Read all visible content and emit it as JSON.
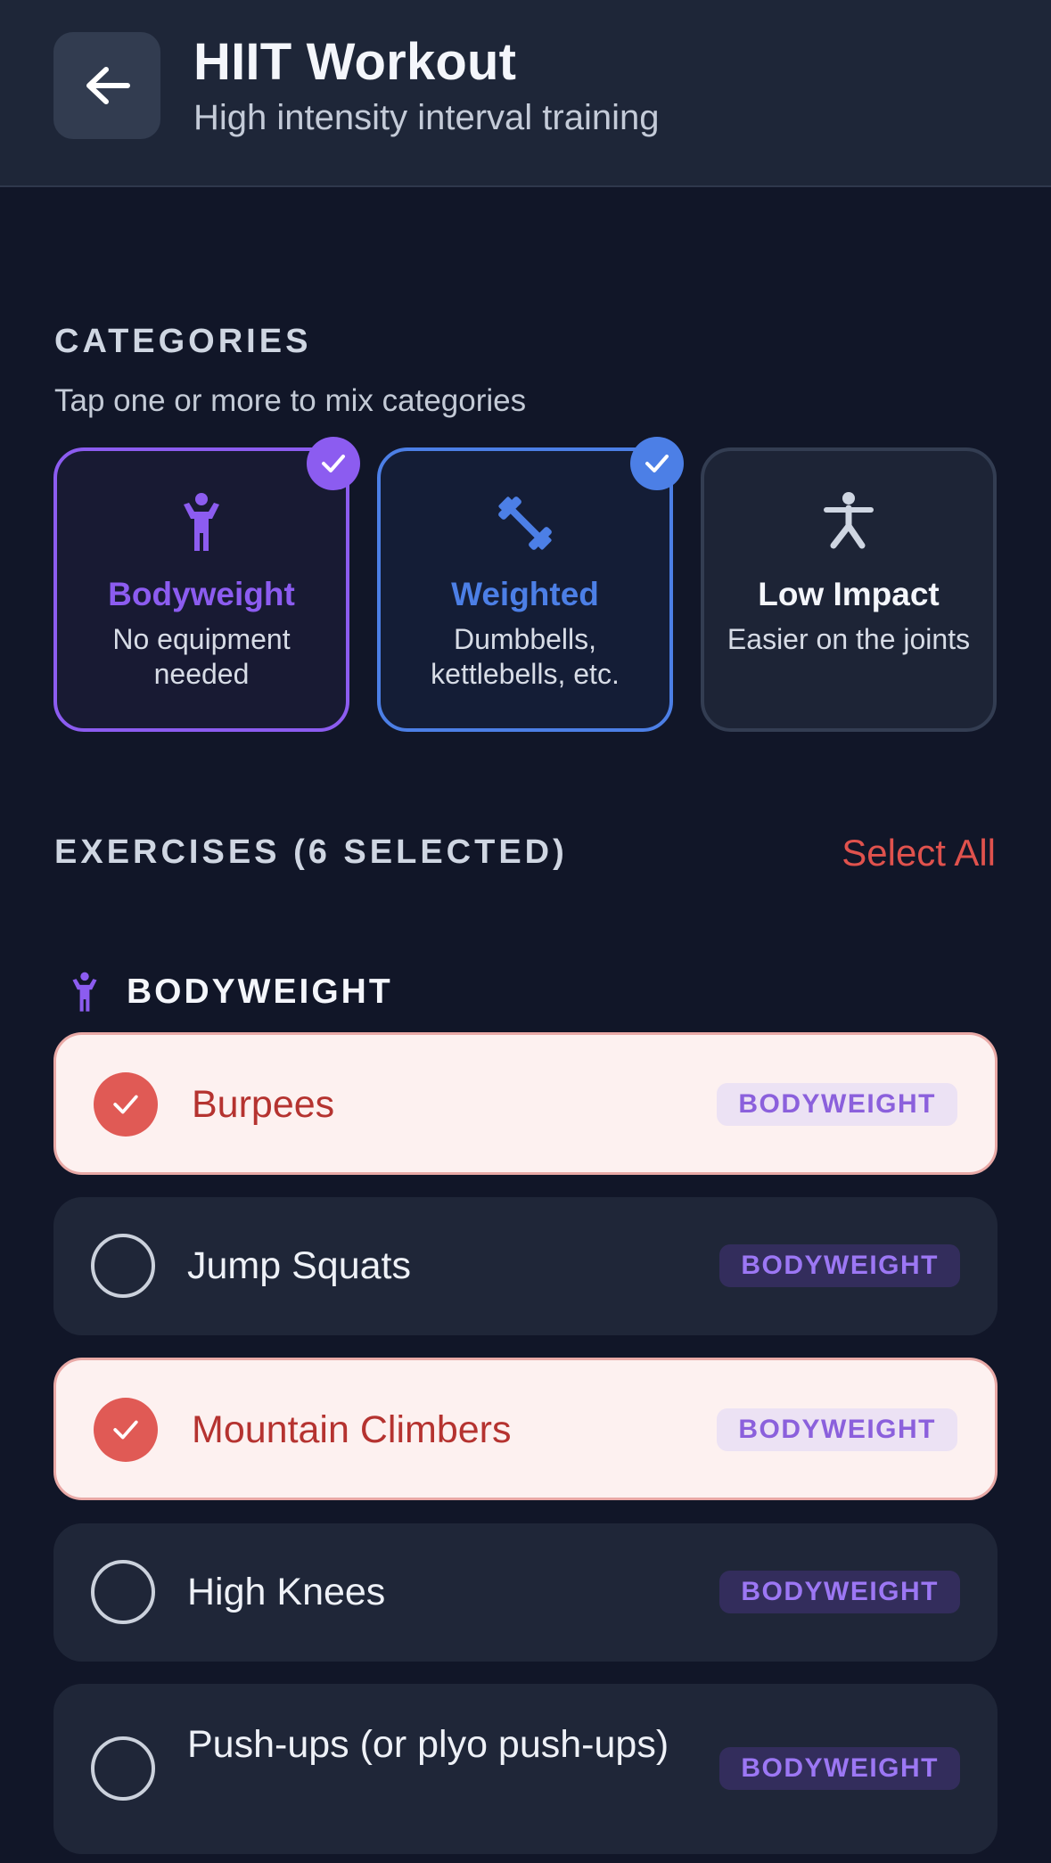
{
  "header": {
    "title": "HIIT Workout",
    "subtitle": "High intensity interval training"
  },
  "categories": {
    "section_label": "CATEGORIES",
    "hint": "Tap one or more to mix categories",
    "items": [
      {
        "name": "Bodyweight",
        "desc": "No equipment needed",
        "selected": true,
        "accent": "#8c5cf0",
        "icon": "person-standing-icon"
      },
      {
        "name": "Weighted",
        "desc": "Dumbbells, kettlebells, etc.",
        "selected": true,
        "accent": "#4c7fe6",
        "icon": "dumbbell-icon"
      },
      {
        "name": "Low Impact",
        "desc": "Easier on the joints",
        "selected": false,
        "accent": "#cfd6e2",
        "icon": "person-stretch-icon"
      }
    ]
  },
  "exercises": {
    "section_label": "EXERCISES (6 SELECTED)",
    "select_all_label": "Select All",
    "group": {
      "label": "BODYWEIGHT",
      "icon": "person-standing-icon"
    },
    "items": [
      {
        "name": "Burpees",
        "tag": "BODYWEIGHT",
        "selected": true
      },
      {
        "name": "Jump Squats",
        "tag": "BODYWEIGHT",
        "selected": false
      },
      {
        "name": "Mountain Climbers",
        "tag": "BODYWEIGHT",
        "selected": true
      },
      {
        "name": "High Knees",
        "tag": "BODYWEIGHT",
        "selected": false
      },
      {
        "name": "Push-ups (or plyo push-ups)",
        "tag": "BODYWEIGHT",
        "selected": false
      }
    ]
  },
  "colors": {
    "background": "#111628",
    "accent_red": "#e0524d",
    "bodyweight": "#8c5cf0",
    "weighted": "#4c7fe6"
  }
}
